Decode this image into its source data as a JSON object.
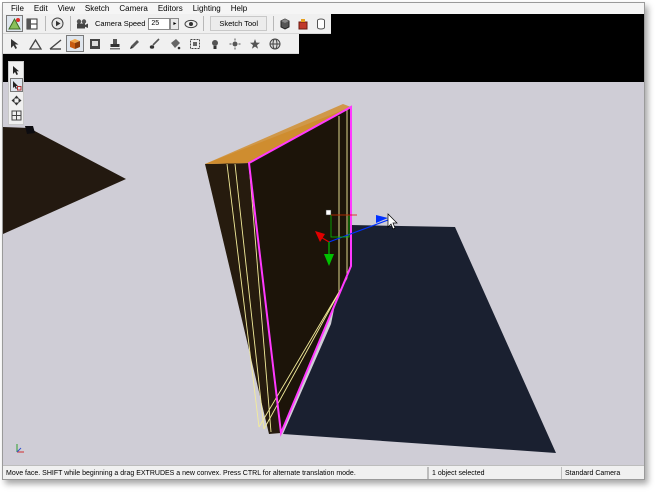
{
  "menu": [
    "File",
    "Edit",
    "View",
    "Sketch",
    "Camera",
    "Editors",
    "Lighting",
    "Help"
  ],
  "toolbar": {
    "camera_speed_label": "Camera Speed",
    "camera_speed_value": "25",
    "sketch_tool_label": "Sketch Tool",
    "main_icons": [
      "add-scene-icon",
      "layout-icon",
      "play-icon",
      "camera-icon",
      "eye-icon",
      "object-icon",
      "material-icon",
      "cylinder-icon"
    ],
    "mode_icons": [
      "pointer-icon",
      "triangle-icon",
      "edge-icon",
      "cube-icon",
      "camera-edit-icon",
      "stamp-icon",
      "paint-icon",
      "brush-icon",
      "bucket-icon",
      "frame-icon",
      "light-icon",
      "sun-icon",
      "star-icon",
      "globe-icon"
    ],
    "left_icons": [
      "select-arrow-icon",
      "sketch-tool-icon",
      "move-tool-icon",
      "snap-tool-icon"
    ]
  },
  "viewport": {
    "background": "#cfcdd6",
    "wall_side_color": "#261b0e",
    "wall_top_color": "#c8852a",
    "selected_face_color": "#ff39ff",
    "shadow_color": "#1a2030",
    "gizmo_colors": {
      "x": "#e00000",
      "y": "#00c000",
      "z": "#0030ff"
    }
  },
  "status": {
    "hint": "Move face.  SHIFT while beginning a drag EXTRUDES a new convex.  Press CTRL for alternate translation mode.",
    "selection": "1 object selected",
    "camera": "Standard Camera"
  }
}
